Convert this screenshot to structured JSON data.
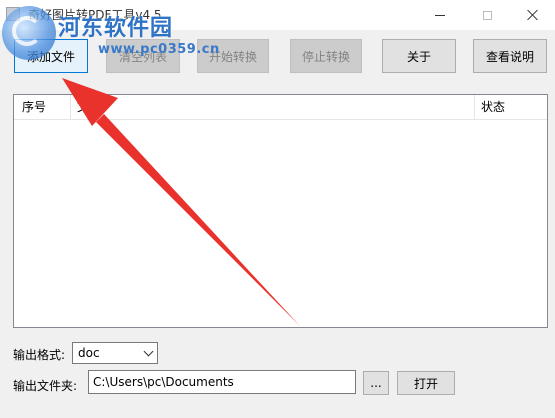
{
  "window": {
    "title": "奇好图片转PDF工具v4.5",
    "icon": "app-icon",
    "controls": {
      "minimize": "minimize-icon",
      "maximize": "maximize-icon",
      "close": "close-icon"
    }
  },
  "watermark": {
    "title": "河东软件园",
    "url": "www.pc0359.cn"
  },
  "toolbar": {
    "add_files": "添加文件",
    "clear_list": "清空列表",
    "start_convert": "开始转换",
    "stop_convert": "停止转换",
    "about": "关于",
    "view_help": "查看说明"
  },
  "file_list": {
    "columns": [
      "序号",
      "文件",
      "状态"
    ],
    "rows": []
  },
  "output": {
    "format_label": "输出格式:",
    "format_value": "doc",
    "folder_label": "输出文件夹:",
    "folder_value": "C:\\Users\\pc\\Documents",
    "browse_label": "...",
    "open_label": "打开"
  },
  "colors": {
    "accent_focus": "#0078d7",
    "annotation_arrow": "#e8322b",
    "watermark_blue": "#2f73c6"
  }
}
